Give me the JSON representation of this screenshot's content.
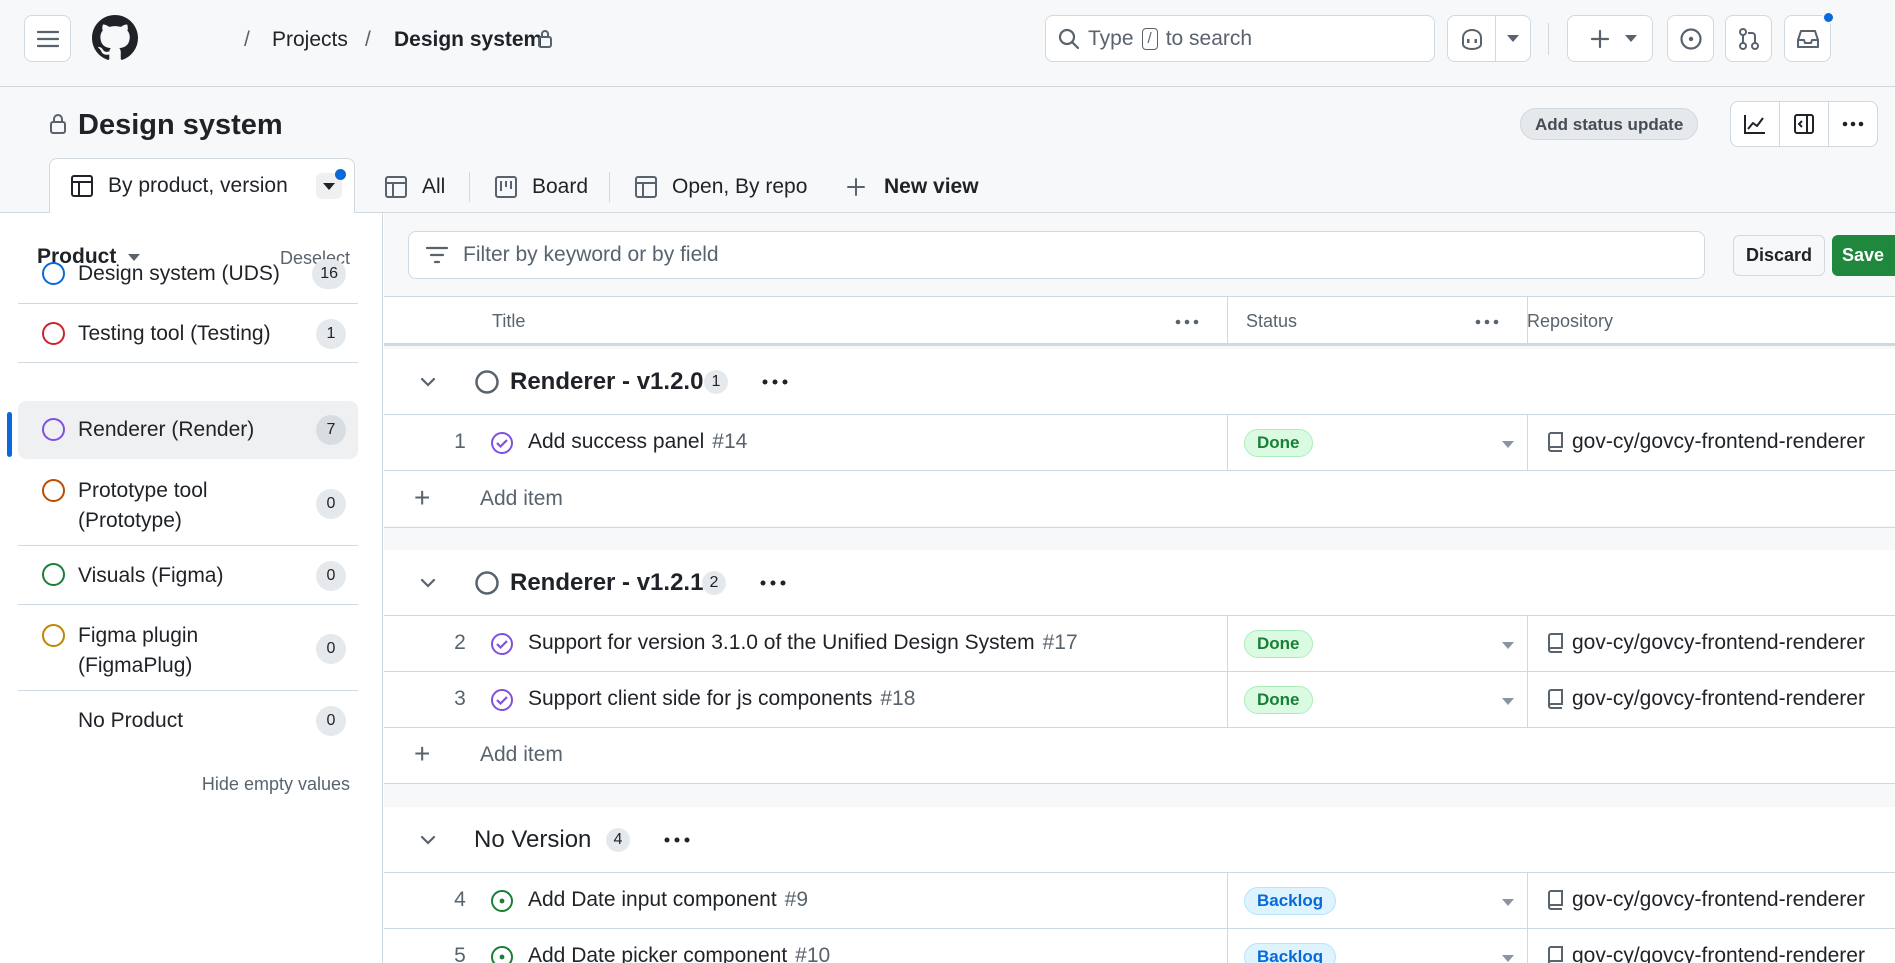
{
  "header": {
    "breadcrumb": [
      "Projects",
      "Design system"
    ],
    "search_prefix": "Type",
    "search_key": "/",
    "search_suffix": "to search"
  },
  "project": {
    "title": "Design system",
    "status_button": "Add status update",
    "tabs": [
      "By product, version",
      "All",
      "Board",
      "Open, By repo",
      "New view"
    ]
  },
  "sidebar": {
    "heading": "Product",
    "deselect": "Deselect",
    "items": [
      {
        "label": "Design system (UDS)",
        "count": "16",
        "color": "#0969da"
      },
      {
        "label": "Testing tool (Testing)",
        "count": "1",
        "color": "#cf222e"
      },
      {
        "label": "Renderer (Render)",
        "count": "7",
        "color": "#8250df"
      },
      {
        "label": "Prototype tool (Prototype)",
        "count": "0",
        "color": "#bc4c00"
      },
      {
        "label": "Visuals (Figma)",
        "count": "0",
        "color": "#1a7f37"
      },
      {
        "label": "Figma plugin (FigmaPlug)",
        "count": "0",
        "color": "#9a6700"
      },
      {
        "label": "No Product",
        "count": "0",
        "color": ""
      }
    ],
    "hide_empty": "Hide empty values"
  },
  "toolbar": {
    "filter_placeholder": "Filter by keyword or by field",
    "discard": "Discard",
    "save": "Save"
  },
  "table": {
    "columns": [
      "Title",
      "Status",
      "Repository"
    ],
    "add_item": "Add item",
    "groups": [
      {
        "title": "Renderer - v1.2.0",
        "count": "1",
        "rows": [
          {
            "num": "1",
            "title": "Add success panel",
            "issue": "#14",
            "status": "Done",
            "repo": "gov-cy/govcy-frontend-renderer"
          }
        ]
      },
      {
        "title": "Renderer - v1.2.1",
        "count": "2",
        "rows": [
          {
            "num": "2",
            "title": "Support for version 3.1.0 of the Unified Design System",
            "issue": "#17",
            "status": "Done",
            "repo": "gov-cy/govcy-frontend-renderer"
          },
          {
            "num": "3",
            "title": "Support client side for js components",
            "issue": "#18",
            "status": "Done",
            "repo": "gov-cy/govcy-frontend-renderer"
          }
        ]
      },
      {
        "title": "No Version",
        "count": "4",
        "rows": [
          {
            "num": "4",
            "title": "Add Date input component",
            "issue": "#9",
            "status": "Backlog",
            "repo": "gov-cy/govcy-frontend-renderer"
          },
          {
            "num": "5",
            "title": "Add Date picker component",
            "issue": "#10",
            "status": "Backlog",
            "repo": "gov-cy/govcy-frontend-renderer"
          }
        ]
      }
    ]
  }
}
